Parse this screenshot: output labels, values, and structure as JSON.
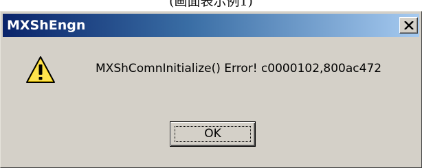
{
  "caption": {
    "text": "(画面表示例1)"
  },
  "window": {
    "title": "MXShEngn",
    "close_glyph": "X"
  },
  "dialog": {
    "icon": "warning-icon",
    "message": "MXShComnInitialize() Error! c0000102,800ac472",
    "ok_label": "OK"
  },
  "colors": {
    "face": "#d4d0c8",
    "titlebar_start": "#0a246a",
    "titlebar_end": "#a6caf0",
    "warning_yellow": "#ffd700"
  }
}
